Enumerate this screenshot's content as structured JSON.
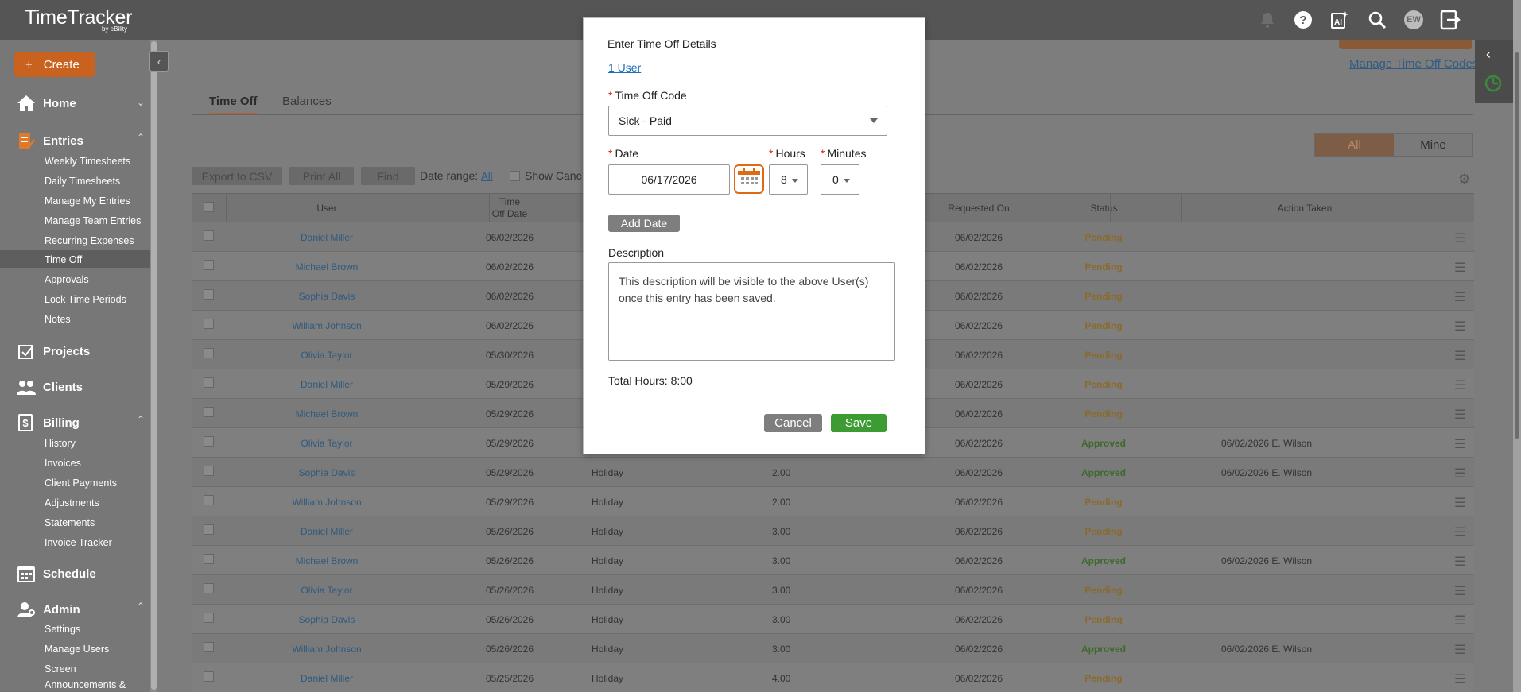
{
  "app": {
    "logo_text": "TimeTracker",
    "logo_sub": "by eBility",
    "user_initials": "EW",
    "ai_label": "AI"
  },
  "sidebar": {
    "create_label": "Create",
    "sections": [
      {
        "label": "Home",
        "icon": "home-icon"
      },
      {
        "label": "Entries",
        "icon": "entries-icon",
        "items": [
          "Weekly Timesheets",
          "Daily Timesheets",
          "Manage My Entries",
          "Manage Team Entries",
          "Recurring Expenses",
          "Time Off",
          "Approvals",
          "Lock Time Periods",
          "Notes"
        ]
      },
      {
        "label": "Projects",
        "icon": "projects-icon"
      },
      {
        "label": "Clients",
        "icon": "clients-icon"
      },
      {
        "label": "Billing",
        "icon": "billing-icon",
        "items": [
          "History",
          "Invoices",
          "Client Payments",
          "Adjustments",
          "Statements",
          "Invoice Tracker"
        ]
      },
      {
        "label": "Schedule",
        "icon": "schedule-icon"
      },
      {
        "label": "Admin",
        "icon": "admin-icon",
        "items": [
          "Settings",
          "Manage Users",
          "Screen",
          "Announcements &"
        ]
      }
    ],
    "active_item": "Time Off"
  },
  "page": {
    "manage_link": "Manage Time Off Codes",
    "tabs": [
      "Time Off",
      "Balances"
    ],
    "toolbar": {
      "export": "Export to CSV",
      "print": "Print All",
      "find": "Find",
      "date_range_label": "Date range:",
      "date_range_value": "All",
      "show_canceled": "Show Canc"
    },
    "segment": {
      "all": "All",
      "mine": "Mine"
    },
    "table": {
      "headers": {
        "user": "User",
        "date1": "Time",
        "date2": "Off Date",
        "requested": "Requested On",
        "status": "Status",
        "action": "Action Taken"
      },
      "rows": [
        {
          "user": "Daniel Miller",
          "date": "06/02/2026",
          "code": "",
          "hours": "",
          "requested": "06/02/2026",
          "status": "Pending",
          "action": ""
        },
        {
          "user": "Michael Brown",
          "date": "06/02/2026",
          "code": "",
          "hours": "",
          "requested": "06/02/2026",
          "status": "Pending",
          "action": ""
        },
        {
          "user": "Sophia Davis",
          "date": "06/02/2026",
          "code": "",
          "hours": "",
          "requested": "06/02/2026",
          "status": "Pending",
          "action": ""
        },
        {
          "user": "William Johnson",
          "date": "06/02/2026",
          "code": "",
          "hours": "",
          "requested": "06/02/2026",
          "status": "Pending",
          "action": ""
        },
        {
          "user": "Olivia Taylor",
          "date": "05/30/2026",
          "code": "",
          "hours": "",
          "requested": "06/02/2026",
          "status": "Pending",
          "action": ""
        },
        {
          "user": "Daniel Miller",
          "date": "05/29/2026",
          "code": "",
          "hours": "",
          "requested": "06/02/2026",
          "status": "Pending",
          "action": ""
        },
        {
          "user": "Michael Brown",
          "date": "05/29/2026",
          "code": "",
          "hours": "",
          "requested": "06/02/2026",
          "status": "Pending",
          "action": ""
        },
        {
          "user": "Olivia Taylor",
          "date": "05/29/2026",
          "code": "",
          "hours": "",
          "requested": "06/02/2026",
          "status": "Approved",
          "action": "06/02/2026 E. Wilson"
        },
        {
          "user": "Sophia Davis",
          "date": "05/29/2026",
          "code": "Holiday",
          "hours": "2.00",
          "requested": "06/02/2026",
          "status": "Approved",
          "action": "06/02/2026 E. Wilson"
        },
        {
          "user": "William Johnson",
          "date": "05/29/2026",
          "code": "Holiday",
          "hours": "2.00",
          "requested": "06/02/2026",
          "status": "Pending",
          "action": ""
        },
        {
          "user": "Daniel Miller",
          "date": "05/26/2026",
          "code": "Holiday",
          "hours": "3.00",
          "requested": "06/02/2026",
          "status": "Pending",
          "action": ""
        },
        {
          "user": "Michael Brown",
          "date": "05/26/2026",
          "code": "Holiday",
          "hours": "3.00",
          "requested": "06/02/2026",
          "status": "Approved",
          "action": "06/02/2026 E. Wilson"
        },
        {
          "user": "Olivia Taylor",
          "date": "05/26/2026",
          "code": "Holiday",
          "hours": "3.00",
          "requested": "06/02/2026",
          "status": "Pending",
          "action": ""
        },
        {
          "user": "Sophia Davis",
          "date": "05/26/2026",
          "code": "Holiday",
          "hours": "3.00",
          "requested": "06/02/2026",
          "status": "Pending",
          "action": ""
        },
        {
          "user": "William Johnson",
          "date": "05/26/2026",
          "code": "Holiday",
          "hours": "3.00",
          "requested": "06/02/2026",
          "status": "Approved",
          "action": "06/02/2026 E. Wilson"
        },
        {
          "user": "Daniel Miller",
          "date": "05/25/2026",
          "code": "Holiday",
          "hours": "4.00",
          "requested": "06/02/2026",
          "status": "Pending",
          "action": ""
        }
      ]
    }
  },
  "modal": {
    "title": "Enter Time Off Details",
    "users_link": "1 User",
    "code_label": "Time Off Code",
    "code_value": "Sick - Paid",
    "date_label": "Date",
    "date_value": "06/17/2026",
    "hours_label": "Hours",
    "hours_value": "8",
    "minutes_label": "Minutes",
    "minutes_value": "0",
    "add_date": "Add Date",
    "description_label": "Description",
    "description_value": "This description will be visible to the above User(s) once this entry has been saved.",
    "total": "Total Hours: 8:00",
    "cancel": "Cancel",
    "save": "Save"
  },
  "colors": {
    "accent": "#E06A14",
    "save_green": "#3C9B32",
    "link_blue": "#1F6FB8",
    "required_red": "#D32020"
  }
}
